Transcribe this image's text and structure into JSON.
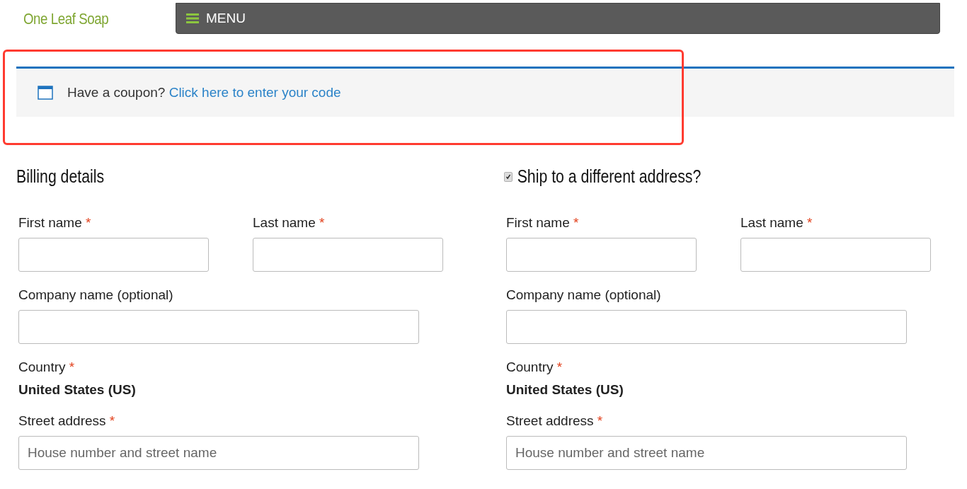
{
  "brand": "One Leaf Soap",
  "menu": {
    "label": "MENU"
  },
  "coupon": {
    "text": "Have a coupon?",
    "link": "Click here to enter your code",
    "highlighted": true
  },
  "billing": {
    "title": "Billing details",
    "fields": [
      {
        "kind": "pair",
        "items": [
          {
            "label": "First name",
            "mark": "*"
          },
          {
            "label": "Last name",
            "mark": "*"
          }
        ]
      },
      {
        "kind": "input",
        "label": "Company name (optional)"
      },
      {
        "kind": "static",
        "label": "Country",
        "mark": "*",
        "value": "United States (US)"
      },
      {
        "kind": "input",
        "label": "Street address",
        "mark": "*",
        "placeholder": "House number and street name"
      }
    ]
  },
  "shipping": {
    "title": "Ship to a different address?",
    "checked": true,
    "fields": [
      {
        "kind": "pair",
        "items": [
          {
            "label": "First name",
            "mark": "*"
          },
          {
            "label": "Last name",
            "mark": "*"
          }
        ]
      },
      {
        "kind": "input",
        "label": "Company name (optional)"
      },
      {
        "kind": "static",
        "label": "Country",
        "mark": "*",
        "value": "United States (US)"
      },
      {
        "kind": "input",
        "label": "Street address",
        "mark": "*",
        "placeholder": "House number and street name"
      }
    ]
  }
}
